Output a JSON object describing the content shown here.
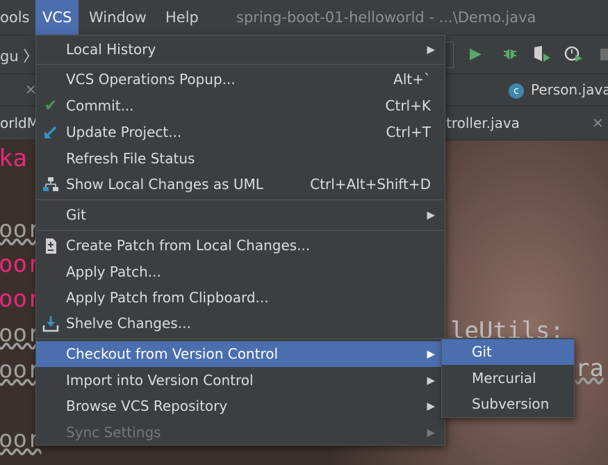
{
  "menubar": {
    "items": [
      "ools",
      "VCS",
      "Window",
      "Help"
    ],
    "title": "spring-boot-01-helloworld - ...\\Demo.java"
  },
  "toolbar": {
    "breadcrumb": "gu 〉I"
  },
  "tabs": {
    "row1_file": "Person.java",
    "row1_icon_letter": "c",
    "row2_left": "orldM",
    "row2_right": "troller.java"
  },
  "code_fragments": {
    "line1": "ka",
    "line2": "oor",
    "line3": "oor",
    "line4": "oor",
    "line5": "oor",
    "line6": "oor",
    "right1": "leUtils;",
    "right2": "ra",
    "line7": "oor"
  },
  "vcs_menu": {
    "items": [
      {
        "label": "Local History",
        "arrow": true
      },
      {
        "label": "VCS Operations Popup...",
        "shortcut": "Alt+`"
      },
      {
        "label": "Commit...",
        "shortcut": "Ctrl+K",
        "icon": "check-icon"
      },
      {
        "label": "Update Project...",
        "shortcut": "Ctrl+T",
        "icon": "update-arrow-icon"
      },
      {
        "label": "Refresh File Status"
      },
      {
        "label": "Show Local Changes as UML",
        "shortcut": "Ctrl+Alt+Shift+D",
        "icon": "uml-diagram-icon"
      },
      {
        "label": "Git",
        "arrow": true
      },
      {
        "label": "Create Patch from Local Changes...",
        "icon": "patch-file-icon"
      },
      {
        "label": "Apply Patch..."
      },
      {
        "label": "Apply Patch from Clipboard..."
      },
      {
        "label": "Shelve Changes...",
        "icon": "shelve-icon"
      },
      {
        "label": "Checkout from Version Control",
        "arrow": true,
        "selected": true
      },
      {
        "label": "Import into Version Control",
        "arrow": true
      },
      {
        "label": "Browse VCS Repository",
        "arrow": true
      },
      {
        "label": "Sync Settings",
        "arrow": true,
        "disabled": true
      }
    ]
  },
  "checkout_submenu": {
    "items": [
      {
        "label": "Git",
        "selected": true
      },
      {
        "label": "Mercurial"
      },
      {
        "label": "Subversion"
      }
    ]
  },
  "colors": {
    "menu_bg": "#3c3f41",
    "selection": "#4b6eaf",
    "check_green": "#499c54",
    "accent_blue": "#3592c4"
  }
}
